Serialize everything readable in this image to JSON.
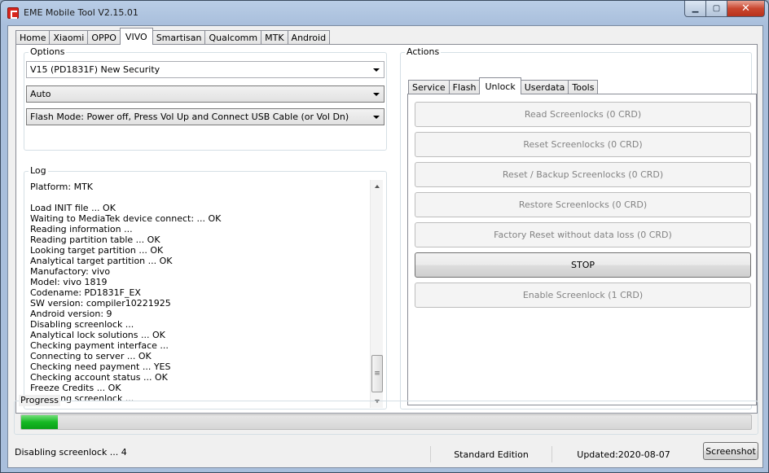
{
  "window": {
    "title": "EME Mobile Tool V2.15.01",
    "controls": {
      "minimize": "▁",
      "maximize": "▢",
      "close": "✕"
    }
  },
  "main_tabs": [
    {
      "label": "Home"
    },
    {
      "label": "Xiaomi"
    },
    {
      "label": "OPPO"
    },
    {
      "label": "VIVO",
      "active": true
    },
    {
      "label": "Smartisan"
    },
    {
      "label": "Qualcomm"
    },
    {
      "label": "MTK"
    },
    {
      "label": "Android"
    }
  ],
  "options": {
    "label": "Options",
    "model_select": "V15 (PD1831F) New Security",
    "mode_select": "Auto",
    "flash_mode_select": "Flash Mode: Power off, Press Vol Up and Connect USB Cable (or Vol Dn)"
  },
  "log": {
    "label": "Log",
    "lines": [
      "Platform: MTK",
      "",
      "Load INIT file ... OK",
      "Waiting to MediaTek device connect: ... OK",
      "Reading information ...",
      "Reading partition table ... OK",
      "Looking target partition ... OK",
      "Analytical target partition ... OK",
      "Manufactory: vivo",
      "Model: vivo 1819",
      "Codename: PD1831F_EX",
      "SW version: compiler10221925",
      "Android version: 9",
      "Disabling screenlock ...",
      "Analytical lock solutions ... OK",
      "Checking payment interface ...",
      "Connecting to server ... OK",
      "Checking need payment ... YES",
      "Checking account status ... OK",
      "Freeze Credits ... OK",
      "Disabling screenlock ..."
    ],
    "scrollbar_thumb_glyph": "≡"
  },
  "actions": {
    "label": "Actions",
    "tabs": [
      {
        "label": "Service"
      },
      {
        "label": "Flash"
      },
      {
        "label": "Unlock",
        "active": true
      },
      {
        "label": "Userdata"
      },
      {
        "label": "Tools"
      }
    ],
    "buttons": [
      {
        "label": "Read Screenlocks (0 CRD)",
        "enabled": false
      },
      {
        "label": "Reset Screenlocks (0 CRD)",
        "enabled": false
      },
      {
        "label": "Reset / Backup Screenlocks (0 CRD)",
        "enabled": false
      },
      {
        "label": "Restore Screenlocks (0 CRD)",
        "enabled": false
      },
      {
        "label": "Factory Reset without data loss (0 CRD)",
        "enabled": false
      },
      {
        "label": "STOP",
        "enabled": true
      },
      {
        "label": "Enable Screenlock (1 CRD)",
        "enabled": false
      }
    ]
  },
  "progress": {
    "label": "Progress",
    "value_fraction": 0.05
  },
  "status_bar": {
    "status_text": "Disabling screenlock ... 4",
    "edition": "Standard Edition",
    "updated": "Updated:2020-08-07",
    "screenshot_button": "Screenshot"
  },
  "colors": {
    "progress_green": "#16b824",
    "app_icon_red": "#d8261c",
    "close_button_red": "#c9462f"
  }
}
